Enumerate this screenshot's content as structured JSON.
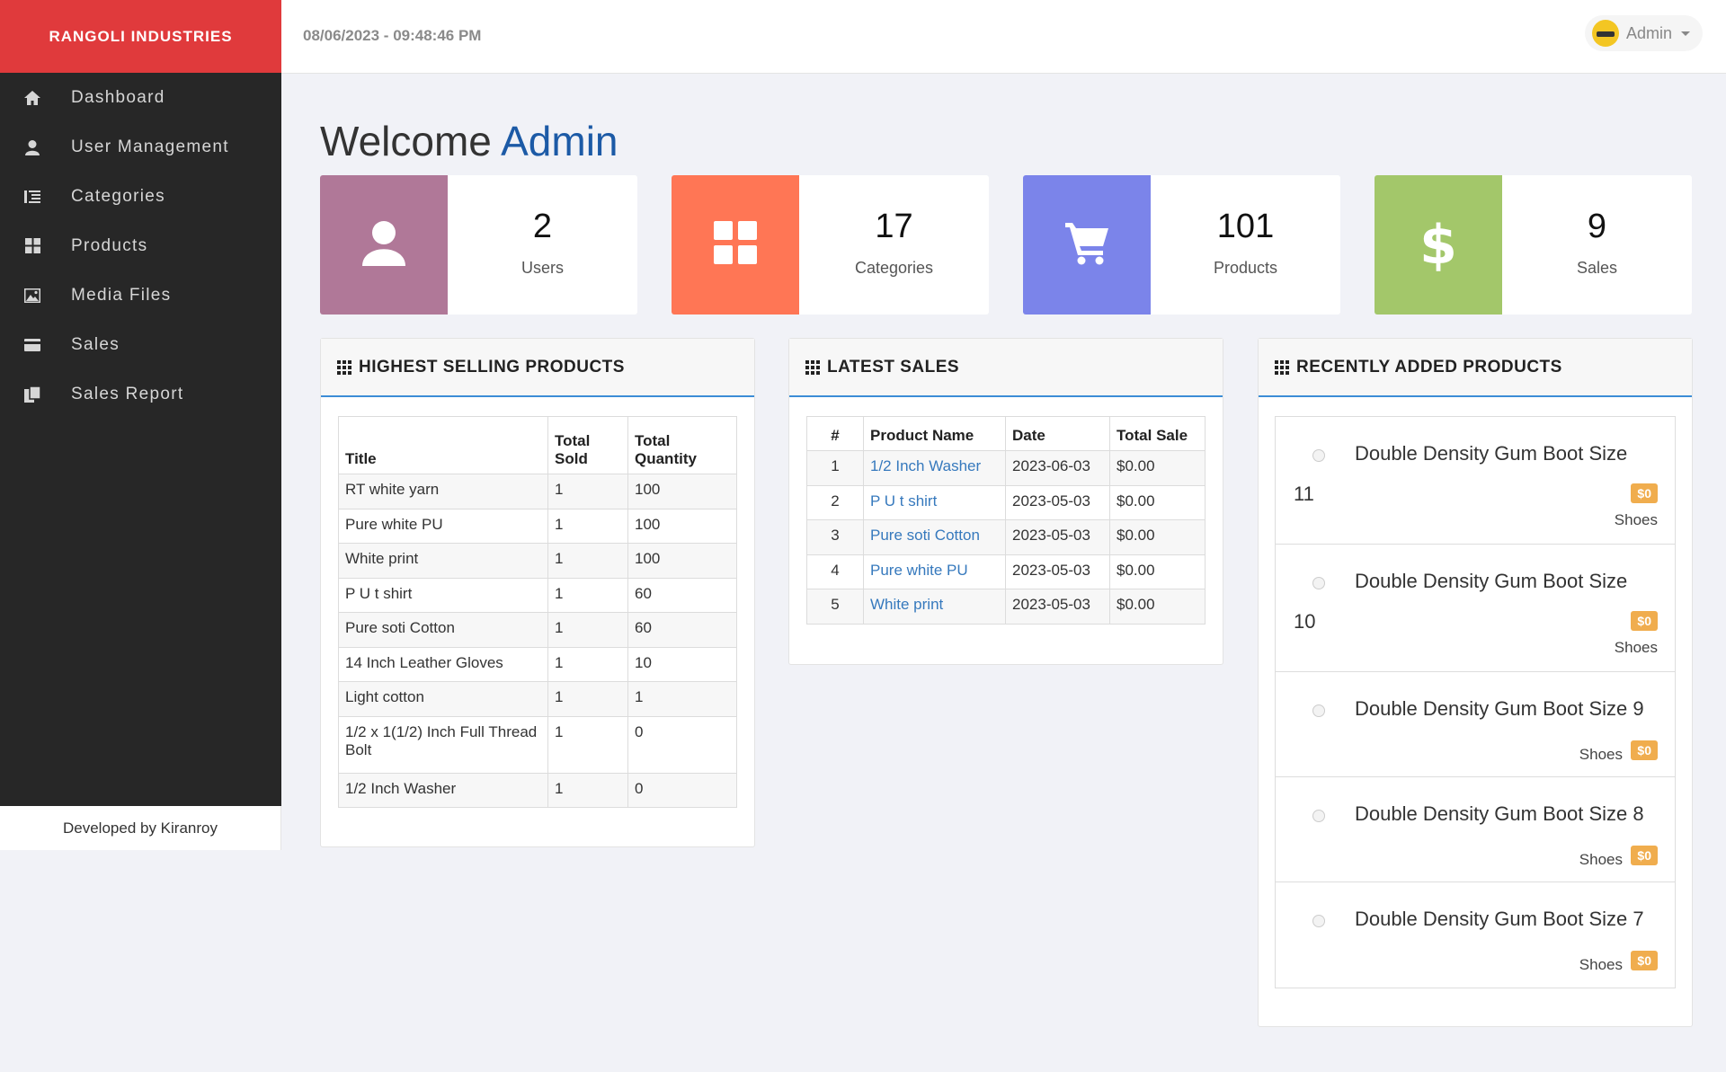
{
  "brand": "RANGOLI INDUSTRIES",
  "datetime": "08/06/2023 - 09:48:46 PM",
  "user": {
    "name": "Admin"
  },
  "sidebar": {
    "items": [
      {
        "label": "Dashboard",
        "icon": "home-icon"
      },
      {
        "label": "User Management",
        "icon": "user-icon"
      },
      {
        "label": "Categories",
        "icon": "indent-icon"
      },
      {
        "label": "Products",
        "icon": "th-large-icon"
      },
      {
        "label": "Media Files",
        "icon": "picture-icon"
      },
      {
        "label": "Sales",
        "icon": "credit-card-icon"
      },
      {
        "label": "Sales Report",
        "icon": "duplicate-icon"
      }
    ],
    "footer": "Developed by Kiranroy"
  },
  "welcome": {
    "prefix": "Welcome",
    "name": "Admin"
  },
  "stats": [
    {
      "value": "2",
      "label": "Users",
      "color": "#b07898",
      "icon": "user-icon"
    },
    {
      "value": "17",
      "label": "Categories",
      "color": "#ff7655",
      "icon": "th-large-icon"
    },
    {
      "value": "101",
      "label": "Products",
      "color": "#7b84ea",
      "icon": "shopping-cart-icon"
    },
    {
      "value": "9",
      "label": "Sales",
      "color": "#a3c76a",
      "icon": "dollar-icon"
    }
  ],
  "highest_selling": {
    "title": "HIGHEST SELLING PRODUCTS",
    "headers": {
      "title": "Title",
      "sold_1": "Total",
      "sold_2": "Sold",
      "qty_1": "Total",
      "qty_2": "Quantity"
    },
    "rows": [
      {
        "title": "RT white yarn",
        "sold": "1",
        "qty": "100"
      },
      {
        "title": "Pure white PU",
        "sold": "1",
        "qty": "100"
      },
      {
        "title": "White print",
        "sold": "1",
        "qty": "100"
      },
      {
        "title": "P U t shirt",
        "sold": "1",
        "qty": "60"
      },
      {
        "title": "Pure soti Cotton",
        "sold": "1",
        "qty": "60"
      },
      {
        "title": "14 Inch Leather Gloves",
        "sold": "1",
        "qty": "10"
      },
      {
        "title": "Light cotton",
        "sold": "1",
        "qty": "1"
      },
      {
        "title": "1/2 x 1(1/2) Inch Full Thread Bolt",
        "sold": "1",
        "qty": "0"
      },
      {
        "title": "1/2 Inch Washer",
        "sold": "1",
        "qty": "0"
      }
    ]
  },
  "latest_sales": {
    "title": "LATEST SALES",
    "headers": {
      "num": "#",
      "name": "Product Name",
      "date": "Date",
      "total": "Total Sale"
    },
    "rows": [
      {
        "num": "1",
        "name": "1/2 Inch Washer",
        "date": "2023-06-03",
        "total": "$0.00"
      },
      {
        "num": "2",
        "name": "P U t shirt",
        "date": "2023-05-03",
        "total": "$0.00"
      },
      {
        "num": "3",
        "name": "Pure soti Cotton",
        "date": "2023-05-03",
        "total": "$0.00"
      },
      {
        "num": "4",
        "name": "Pure white PU",
        "date": "2023-05-03",
        "total": "$0.00"
      },
      {
        "num": "5",
        "name": "White print",
        "date": "2023-05-03",
        "total": "$0.00"
      }
    ]
  },
  "recent_products": {
    "title": "RECENTLY ADDED PRODUCTS",
    "items": [
      {
        "title_1": "Double Density Gum Boot Size",
        "title_2": "11",
        "price": "$0",
        "category": "Shoes"
      },
      {
        "title_1": "Double Density Gum Boot Size",
        "title_2": "10",
        "price": "$0",
        "category": "Shoes"
      },
      {
        "title_1": "Double Density Gum Boot Size 9",
        "price": "$0",
        "category": "Shoes"
      },
      {
        "title_1": "Double Density Gum Boot Size 8",
        "price": "$0",
        "category": "Shoes"
      },
      {
        "title_1": "Double Density Gum Boot Size 7",
        "price": "$0",
        "category": "Shoes"
      }
    ]
  }
}
